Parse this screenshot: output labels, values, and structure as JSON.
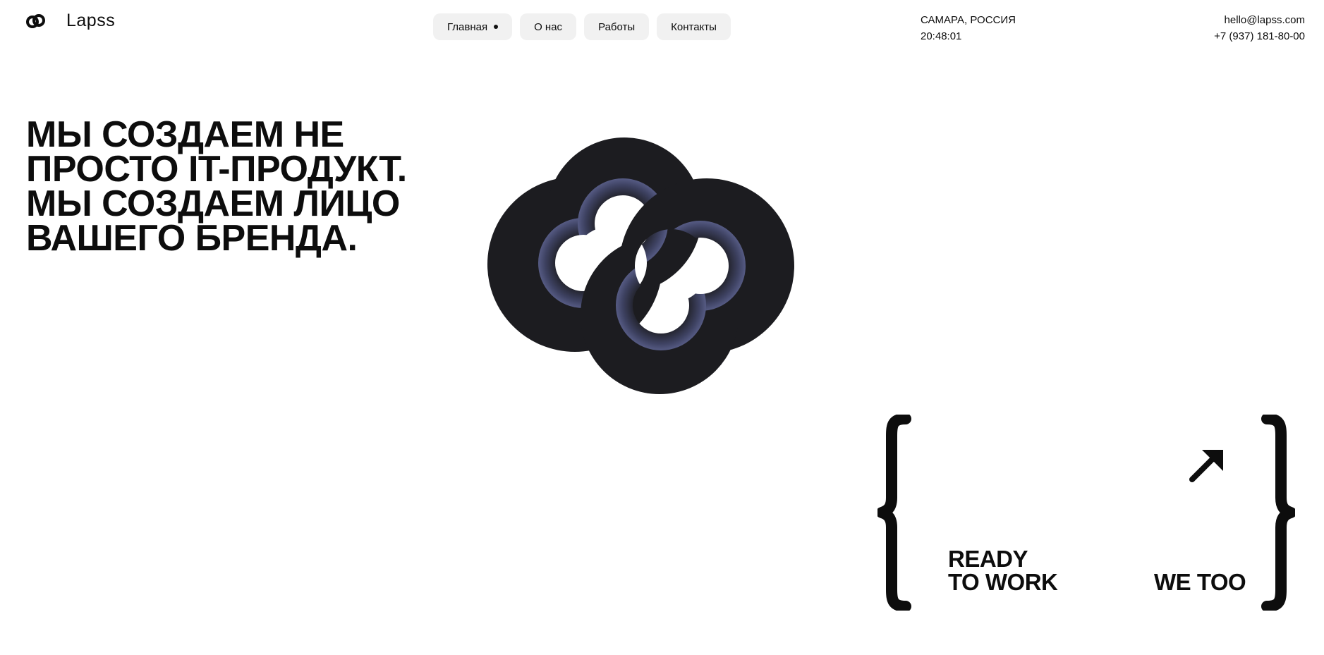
{
  "header": {
    "brand": "Lapss",
    "logo_icon": "linked-rings-icon",
    "nav": [
      {
        "label": "Главная",
        "active": true
      },
      {
        "label": "О нас",
        "active": false
      },
      {
        "label": "Работы",
        "active": false
      },
      {
        "label": "Контакты",
        "active": false
      }
    ],
    "location": "САМАРА, РОССИЯ",
    "time": "20:48:01",
    "email": "hello@lapss.com",
    "phone": "+7 (937) 181-80-00"
  },
  "hero": {
    "headline_lines": [
      "МЫ СОЗДАЕМ НЕ",
      "ПРОСТО IT-ПРОДУКТ.",
      "МЫ СОЗДАЕМ ЛИЦО",
      "ВАШЕГО БРЕНДА."
    ],
    "logo_graphic": "linked-rings-logo"
  },
  "cta": {
    "ready_line1": "READY",
    "ready_line2": "TO WORK",
    "we_too": "WE TOO",
    "arrow_icon": "arrow-up-right-icon",
    "brace_icons": [
      "left-curly-brace-icon",
      "right-curly-brace-icon"
    ]
  },
  "colors": {
    "background": "#ffffff",
    "text": "#0d0d0d",
    "nav_bg": "#f1f1f1",
    "logo_dark": "#1c1c20",
    "logo_glow": "#4a4e72"
  }
}
